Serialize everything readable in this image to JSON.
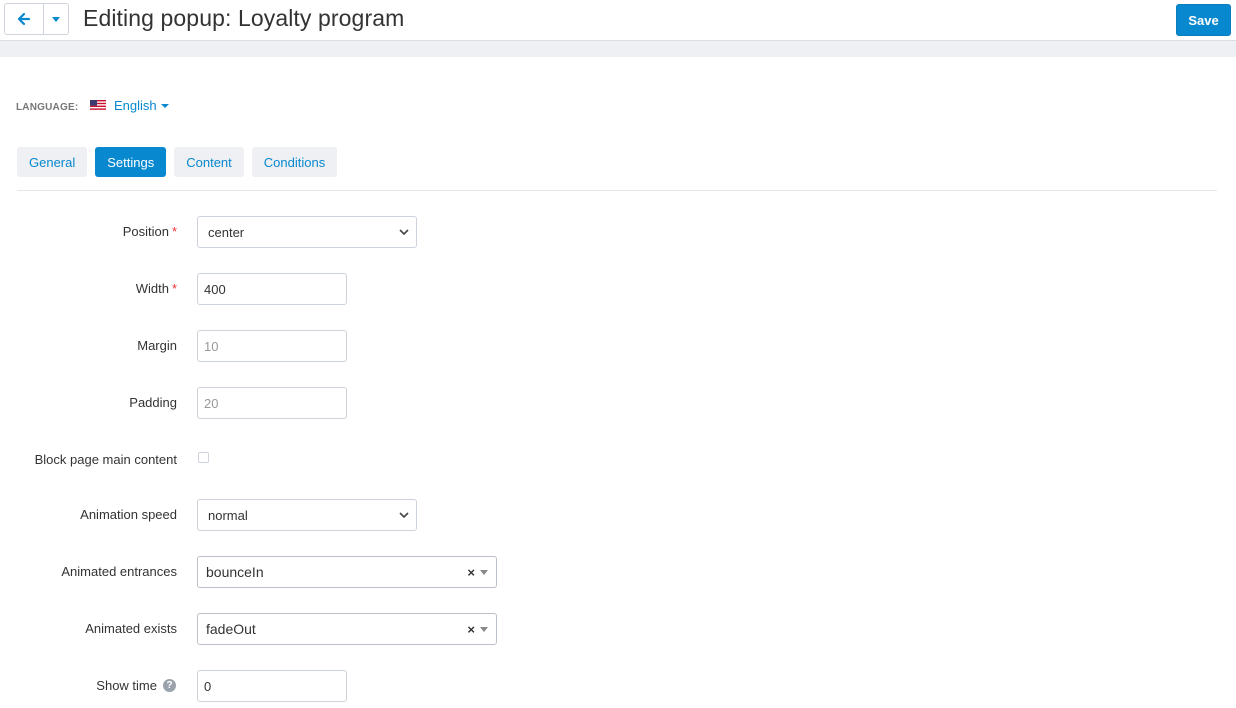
{
  "header": {
    "title": "Editing popup: Loyalty program",
    "save_label": "Save",
    "back_icon": "arrow-left-icon",
    "menu_icon": "caret-down-icon"
  },
  "language": {
    "label": "LANGUAGE:",
    "value": "English",
    "flag_icon": "us-flag-icon"
  },
  "tabs": [
    {
      "label": "General",
      "active": false
    },
    {
      "label": "Settings",
      "active": true
    },
    {
      "label": "Content",
      "active": false
    },
    {
      "label": "Conditions",
      "active": false
    }
  ],
  "form": {
    "position": {
      "label": "Position",
      "value": "center",
      "required": true
    },
    "width": {
      "label": "Width",
      "value": "400",
      "required": true
    },
    "margin": {
      "label": "Margin",
      "placeholder": "10"
    },
    "padding": {
      "label": "Padding",
      "placeholder": "20"
    },
    "block_content": {
      "label": "Block page main content",
      "checked": false
    },
    "animation_speed": {
      "label": "Animation speed",
      "value": "normal"
    },
    "animated_entrances": {
      "label": "Animated entrances",
      "value": "bounceIn"
    },
    "animated_exists": {
      "label": "Animated exists",
      "value": "fadeOut"
    },
    "show_time": {
      "label": "Show time",
      "value": "0"
    }
  },
  "colors": {
    "accent": "#0888cf",
    "required": "#ee3333",
    "tab_bg": "#eef0f3"
  }
}
